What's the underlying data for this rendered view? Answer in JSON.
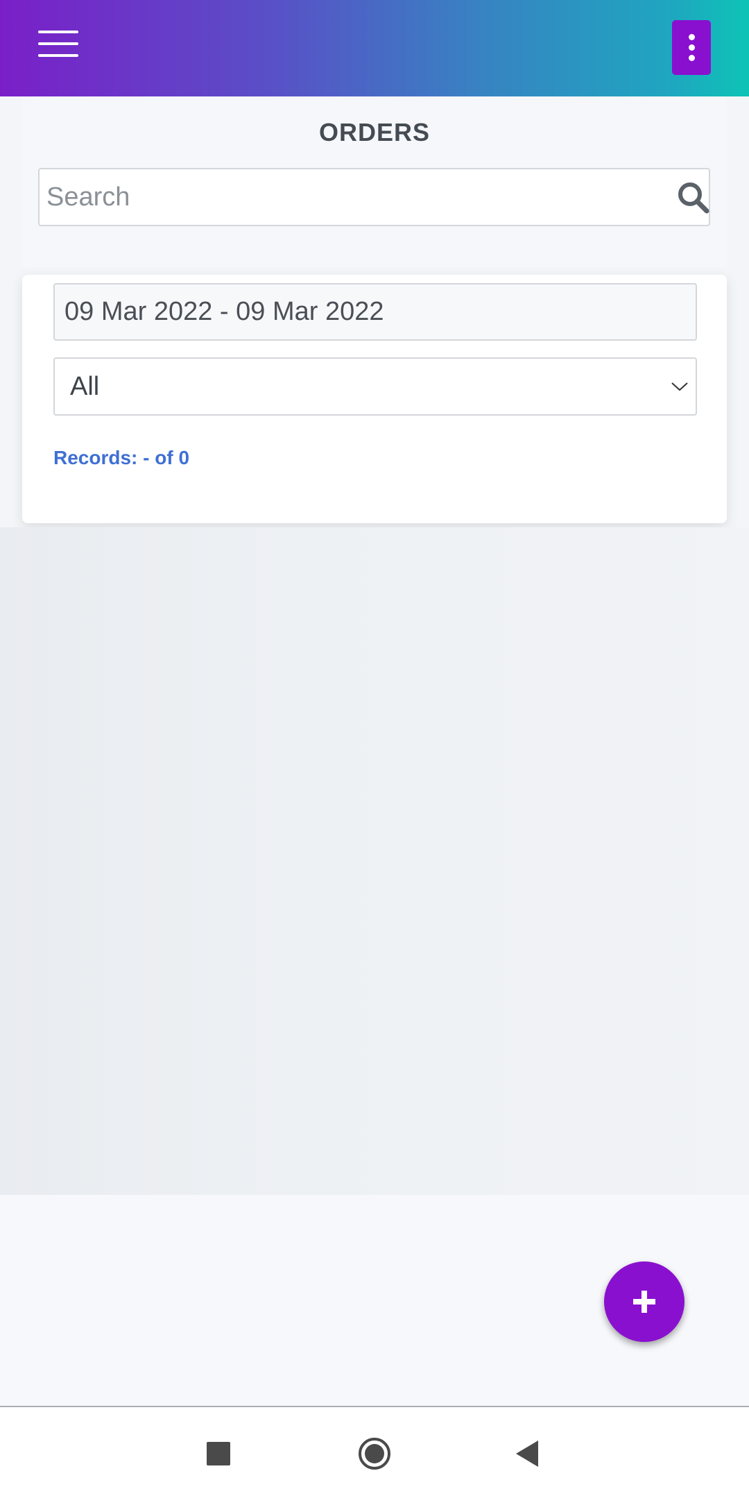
{
  "header": {
    "title": "ORDERS"
  },
  "search": {
    "placeholder": "Search",
    "value": ""
  },
  "filters": {
    "date_range": "09 Mar 2022 - 09 Mar 2022",
    "status_selected": "All"
  },
  "records": {
    "label": "Records: - of 0"
  },
  "fab": {
    "symbol": "+"
  },
  "icons": {
    "menu": "hamburger-menu-icon",
    "more": "more-vertical-icon",
    "search": "search-icon",
    "dropdown": "chevron-down-icon",
    "add": "plus-icon",
    "nav_recent": "square-icon",
    "nav_home": "circle-icon",
    "nav_back": "triangle-back-icon"
  },
  "colors": {
    "accent": "#8a10cf",
    "link": "#3f6fd4",
    "gradient_start": "#7a1fc8",
    "gradient_end": "#0ec4b6"
  }
}
